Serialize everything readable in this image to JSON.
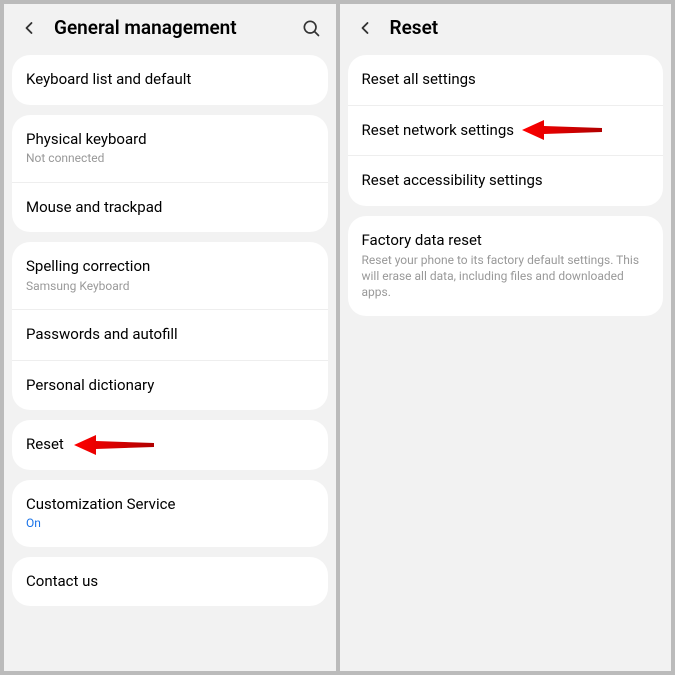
{
  "left": {
    "title": "General management",
    "groups": [
      {
        "items": [
          {
            "title": "Keyboard list and default"
          }
        ]
      },
      {
        "items": [
          {
            "title": "Physical keyboard",
            "sub": "Not connected"
          },
          {
            "title": "Mouse and trackpad"
          }
        ]
      },
      {
        "items": [
          {
            "title": "Spelling correction",
            "sub": "Samsung Keyboard"
          },
          {
            "title": "Passwords and autofill"
          },
          {
            "title": "Personal dictionary"
          }
        ]
      },
      {
        "items": [
          {
            "title": "Reset",
            "highlight": true
          }
        ]
      },
      {
        "items": [
          {
            "title": "Customization Service",
            "sub": "On",
            "subBlue": true
          }
        ]
      },
      {
        "items": [
          {
            "title": "Contact us"
          }
        ]
      }
    ]
  },
  "right": {
    "title": "Reset",
    "groups": [
      {
        "items": [
          {
            "title": "Reset all settings"
          },
          {
            "title": "Reset network settings",
            "highlight": true
          },
          {
            "title": "Reset accessibility settings"
          }
        ]
      },
      {
        "items": [
          {
            "title": "Factory data reset",
            "desc": "Reset your phone to its factory default settings. This will erase all data, including files and downloaded apps."
          }
        ]
      }
    ]
  }
}
